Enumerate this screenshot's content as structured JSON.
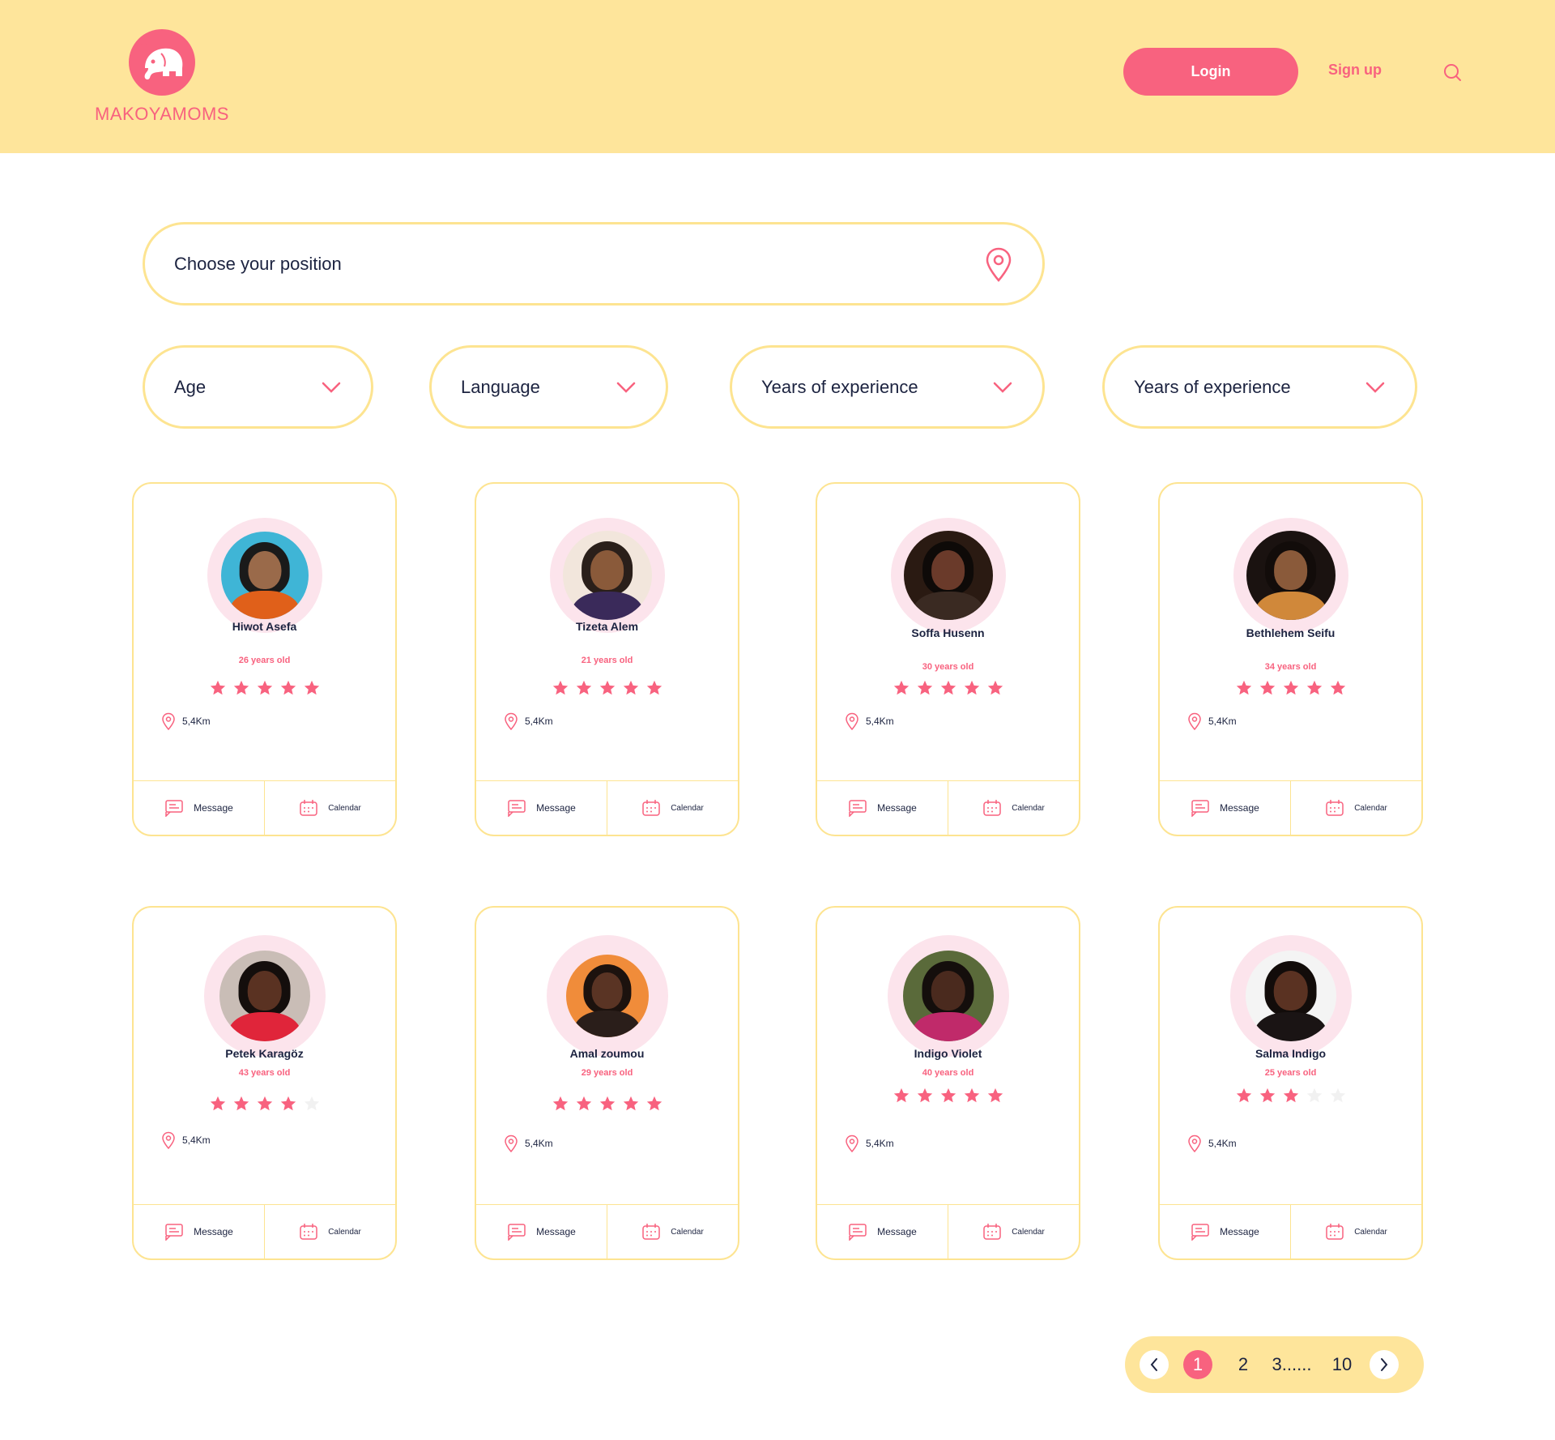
{
  "header": {
    "brand": "MAKOYAMOMS",
    "login_label": "Login",
    "signup_label": "Sign up",
    "icons": [
      "elephant-logo-icon",
      "search-icon"
    ]
  },
  "search": {
    "placeholder": "Choose your position",
    "icon": "location-pin-icon"
  },
  "filters": [
    {
      "label": "Age"
    },
    {
      "label": "Language"
    },
    {
      "label": "Years of experience"
    },
    {
      "label": "Years of experience"
    }
  ],
  "profiles": [
    {
      "name": "Hiwot Asefa",
      "age": "26 years old",
      "rating": 5,
      "distance": "5,4Km",
      "message": "Message",
      "calendar": "Calendar"
    },
    {
      "name": "Tizeta Alem",
      "age": "21 years old",
      "rating": 5,
      "distance": "5,4Km",
      "message": "Message",
      "calendar": "Calendar"
    },
    {
      "name": "Soffa Husenn",
      "age": "30 years old",
      "rating": 5,
      "distance": "5,4Km",
      "message": "Message",
      "calendar": "Calendar"
    },
    {
      "name": "Bethlehem Seifu",
      "age": "34 years old",
      "rating": 5,
      "distance": "5,4Km",
      "message": "Message",
      "calendar": "Calendar"
    },
    {
      "name": "Petek Karagöz",
      "age": "43 years old",
      "rating": 4,
      "distance": "5,4Km",
      "message": "Message",
      "calendar": "Calendar"
    },
    {
      "name": "Amal zoumou",
      "age": "29 years old",
      "rating": 5,
      "distance": "5,4Km",
      "message": "Message",
      "calendar": "Calendar"
    },
    {
      "name": "Indigo Violet",
      "age": "40 years old",
      "rating": 5,
      "distance": "5,4Km",
      "message": "Message",
      "calendar": "Calendar"
    },
    {
      "name": "Salma Indigo",
      "age": "25 years old",
      "rating": 3,
      "distance": "5,4Km",
      "message": "Message",
      "calendar": "Calendar"
    }
  ],
  "pagination": {
    "pages": [
      "1",
      "2",
      "3......",
      "10"
    ],
    "current": "1"
  },
  "colors": {
    "accent": "#f8627f",
    "header_bg": "#fee59b",
    "border": "#fde491",
    "avatar_ring": "#fce4ec",
    "text": "#1c2340"
  }
}
